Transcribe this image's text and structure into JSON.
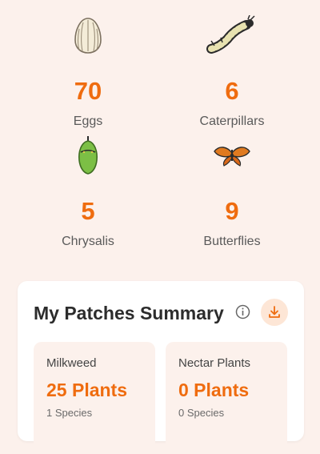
{
  "stats": [
    {
      "value": "70",
      "label": "Eggs",
      "icon": "egg-icon"
    },
    {
      "value": "6",
      "label": "Caterpillars",
      "icon": "caterpillar-icon"
    },
    {
      "value": "5",
      "label": "Chrysalis",
      "icon": "chrysalis-icon"
    },
    {
      "value": "9",
      "label": "Butterflies",
      "icon": "butterfly-icon"
    }
  ],
  "summary": {
    "title": "My Patches Summary",
    "info_icon": "info-icon",
    "download_icon": "download-icon",
    "patches": [
      {
        "name": "Milkweed",
        "count": "25 Plants",
        "species": "1 Species"
      },
      {
        "name": "Nectar Plants",
        "count": "0 Plants",
        "species": "0 Species"
      }
    ]
  },
  "colors": {
    "accent": "#ef6c0f",
    "background": "#fcf1ec",
    "card": "#ffffff"
  }
}
